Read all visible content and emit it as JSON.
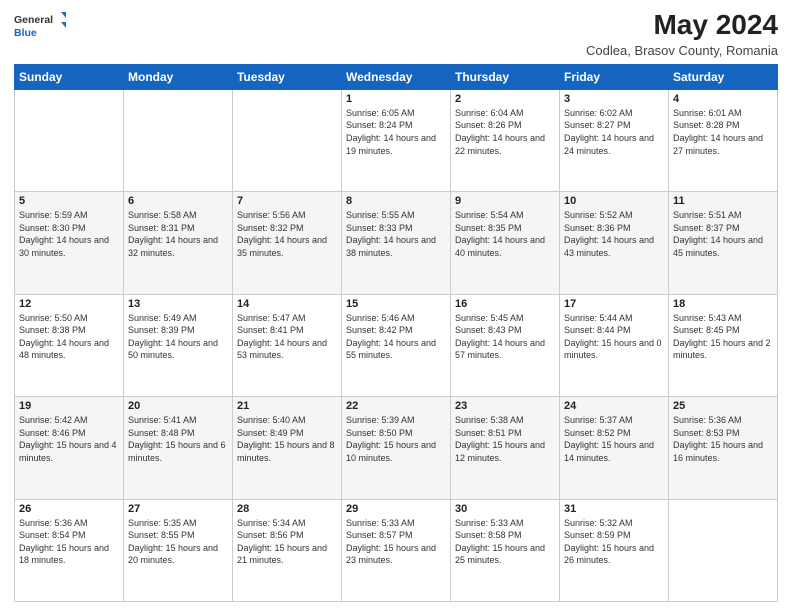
{
  "header": {
    "logo_general": "General",
    "logo_blue": "Blue",
    "month_year": "May 2024",
    "location": "Codlea, Brasov County, Romania"
  },
  "weekdays": [
    "Sunday",
    "Monday",
    "Tuesday",
    "Wednesday",
    "Thursday",
    "Friday",
    "Saturday"
  ],
  "weeks": [
    [
      {
        "day": "",
        "sunrise": "",
        "sunset": "",
        "daylight": ""
      },
      {
        "day": "",
        "sunrise": "",
        "sunset": "",
        "daylight": ""
      },
      {
        "day": "",
        "sunrise": "",
        "sunset": "",
        "daylight": ""
      },
      {
        "day": "1",
        "sunrise": "Sunrise: 6:05 AM",
        "sunset": "Sunset: 8:24 PM",
        "daylight": "Daylight: 14 hours and 19 minutes."
      },
      {
        "day": "2",
        "sunrise": "Sunrise: 6:04 AM",
        "sunset": "Sunset: 8:26 PM",
        "daylight": "Daylight: 14 hours and 22 minutes."
      },
      {
        "day": "3",
        "sunrise": "Sunrise: 6:02 AM",
        "sunset": "Sunset: 8:27 PM",
        "daylight": "Daylight: 14 hours and 24 minutes."
      },
      {
        "day": "4",
        "sunrise": "Sunrise: 6:01 AM",
        "sunset": "Sunset: 8:28 PM",
        "daylight": "Daylight: 14 hours and 27 minutes."
      }
    ],
    [
      {
        "day": "5",
        "sunrise": "Sunrise: 5:59 AM",
        "sunset": "Sunset: 8:30 PM",
        "daylight": "Daylight: 14 hours and 30 minutes."
      },
      {
        "day": "6",
        "sunrise": "Sunrise: 5:58 AM",
        "sunset": "Sunset: 8:31 PM",
        "daylight": "Daylight: 14 hours and 32 minutes."
      },
      {
        "day": "7",
        "sunrise": "Sunrise: 5:56 AM",
        "sunset": "Sunset: 8:32 PM",
        "daylight": "Daylight: 14 hours and 35 minutes."
      },
      {
        "day": "8",
        "sunrise": "Sunrise: 5:55 AM",
        "sunset": "Sunset: 8:33 PM",
        "daylight": "Daylight: 14 hours and 38 minutes."
      },
      {
        "day": "9",
        "sunrise": "Sunrise: 5:54 AM",
        "sunset": "Sunset: 8:35 PM",
        "daylight": "Daylight: 14 hours and 40 minutes."
      },
      {
        "day": "10",
        "sunrise": "Sunrise: 5:52 AM",
        "sunset": "Sunset: 8:36 PM",
        "daylight": "Daylight: 14 hours and 43 minutes."
      },
      {
        "day": "11",
        "sunrise": "Sunrise: 5:51 AM",
        "sunset": "Sunset: 8:37 PM",
        "daylight": "Daylight: 14 hours and 45 minutes."
      }
    ],
    [
      {
        "day": "12",
        "sunrise": "Sunrise: 5:50 AM",
        "sunset": "Sunset: 8:38 PM",
        "daylight": "Daylight: 14 hours and 48 minutes."
      },
      {
        "day": "13",
        "sunrise": "Sunrise: 5:49 AM",
        "sunset": "Sunset: 8:39 PM",
        "daylight": "Daylight: 14 hours and 50 minutes."
      },
      {
        "day": "14",
        "sunrise": "Sunrise: 5:47 AM",
        "sunset": "Sunset: 8:41 PM",
        "daylight": "Daylight: 14 hours and 53 minutes."
      },
      {
        "day": "15",
        "sunrise": "Sunrise: 5:46 AM",
        "sunset": "Sunset: 8:42 PM",
        "daylight": "Daylight: 14 hours and 55 minutes."
      },
      {
        "day": "16",
        "sunrise": "Sunrise: 5:45 AM",
        "sunset": "Sunset: 8:43 PM",
        "daylight": "Daylight: 14 hours and 57 minutes."
      },
      {
        "day": "17",
        "sunrise": "Sunrise: 5:44 AM",
        "sunset": "Sunset: 8:44 PM",
        "daylight": "Daylight: 15 hours and 0 minutes."
      },
      {
        "day": "18",
        "sunrise": "Sunrise: 5:43 AM",
        "sunset": "Sunset: 8:45 PM",
        "daylight": "Daylight: 15 hours and 2 minutes."
      }
    ],
    [
      {
        "day": "19",
        "sunrise": "Sunrise: 5:42 AM",
        "sunset": "Sunset: 8:46 PM",
        "daylight": "Daylight: 15 hours and 4 minutes."
      },
      {
        "day": "20",
        "sunrise": "Sunrise: 5:41 AM",
        "sunset": "Sunset: 8:48 PM",
        "daylight": "Daylight: 15 hours and 6 minutes."
      },
      {
        "day": "21",
        "sunrise": "Sunrise: 5:40 AM",
        "sunset": "Sunset: 8:49 PM",
        "daylight": "Daylight: 15 hours and 8 minutes."
      },
      {
        "day": "22",
        "sunrise": "Sunrise: 5:39 AM",
        "sunset": "Sunset: 8:50 PM",
        "daylight": "Daylight: 15 hours and 10 minutes."
      },
      {
        "day": "23",
        "sunrise": "Sunrise: 5:38 AM",
        "sunset": "Sunset: 8:51 PM",
        "daylight": "Daylight: 15 hours and 12 minutes."
      },
      {
        "day": "24",
        "sunrise": "Sunrise: 5:37 AM",
        "sunset": "Sunset: 8:52 PM",
        "daylight": "Daylight: 15 hours and 14 minutes."
      },
      {
        "day": "25",
        "sunrise": "Sunrise: 5:36 AM",
        "sunset": "Sunset: 8:53 PM",
        "daylight": "Daylight: 15 hours and 16 minutes."
      }
    ],
    [
      {
        "day": "26",
        "sunrise": "Sunrise: 5:36 AM",
        "sunset": "Sunset: 8:54 PM",
        "daylight": "Daylight: 15 hours and 18 minutes."
      },
      {
        "day": "27",
        "sunrise": "Sunrise: 5:35 AM",
        "sunset": "Sunset: 8:55 PM",
        "daylight": "Daylight: 15 hours and 20 minutes."
      },
      {
        "day": "28",
        "sunrise": "Sunrise: 5:34 AM",
        "sunset": "Sunset: 8:56 PM",
        "daylight": "Daylight: 15 hours and 21 minutes."
      },
      {
        "day": "29",
        "sunrise": "Sunrise: 5:33 AM",
        "sunset": "Sunset: 8:57 PM",
        "daylight": "Daylight: 15 hours and 23 minutes."
      },
      {
        "day": "30",
        "sunrise": "Sunrise: 5:33 AM",
        "sunset": "Sunset: 8:58 PM",
        "daylight": "Daylight: 15 hours and 25 minutes."
      },
      {
        "day": "31",
        "sunrise": "Sunrise: 5:32 AM",
        "sunset": "Sunset: 8:59 PM",
        "daylight": "Daylight: 15 hours and 26 minutes."
      },
      {
        "day": "",
        "sunrise": "",
        "sunset": "",
        "daylight": ""
      }
    ]
  ]
}
